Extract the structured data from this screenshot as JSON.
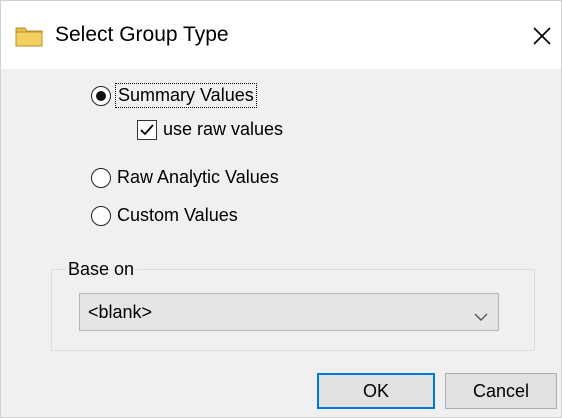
{
  "window": {
    "title": "Select Group Type",
    "title_icon": "folder-icon",
    "close_icon": "close-icon"
  },
  "options": {
    "summary_values": {
      "label": "Summary Values",
      "selected": true
    },
    "use_raw_values": {
      "label": "use raw values",
      "checked": true
    },
    "raw_analytic_values": {
      "label": "Raw Analytic Values",
      "selected": false
    },
    "custom_values": {
      "label": "Custom Values",
      "selected": false
    }
  },
  "base_on": {
    "legend": "Base on",
    "selected": "<blank>",
    "arrow_icon": "chevron-down-icon"
  },
  "buttons": {
    "ok": "OK",
    "cancel": "Cancel"
  },
  "colors": {
    "dialog_background": "#f0f0f0",
    "title_background": "#ffffff",
    "default_button_border": "#0078d7",
    "folder_icon": "#e8c04a"
  }
}
